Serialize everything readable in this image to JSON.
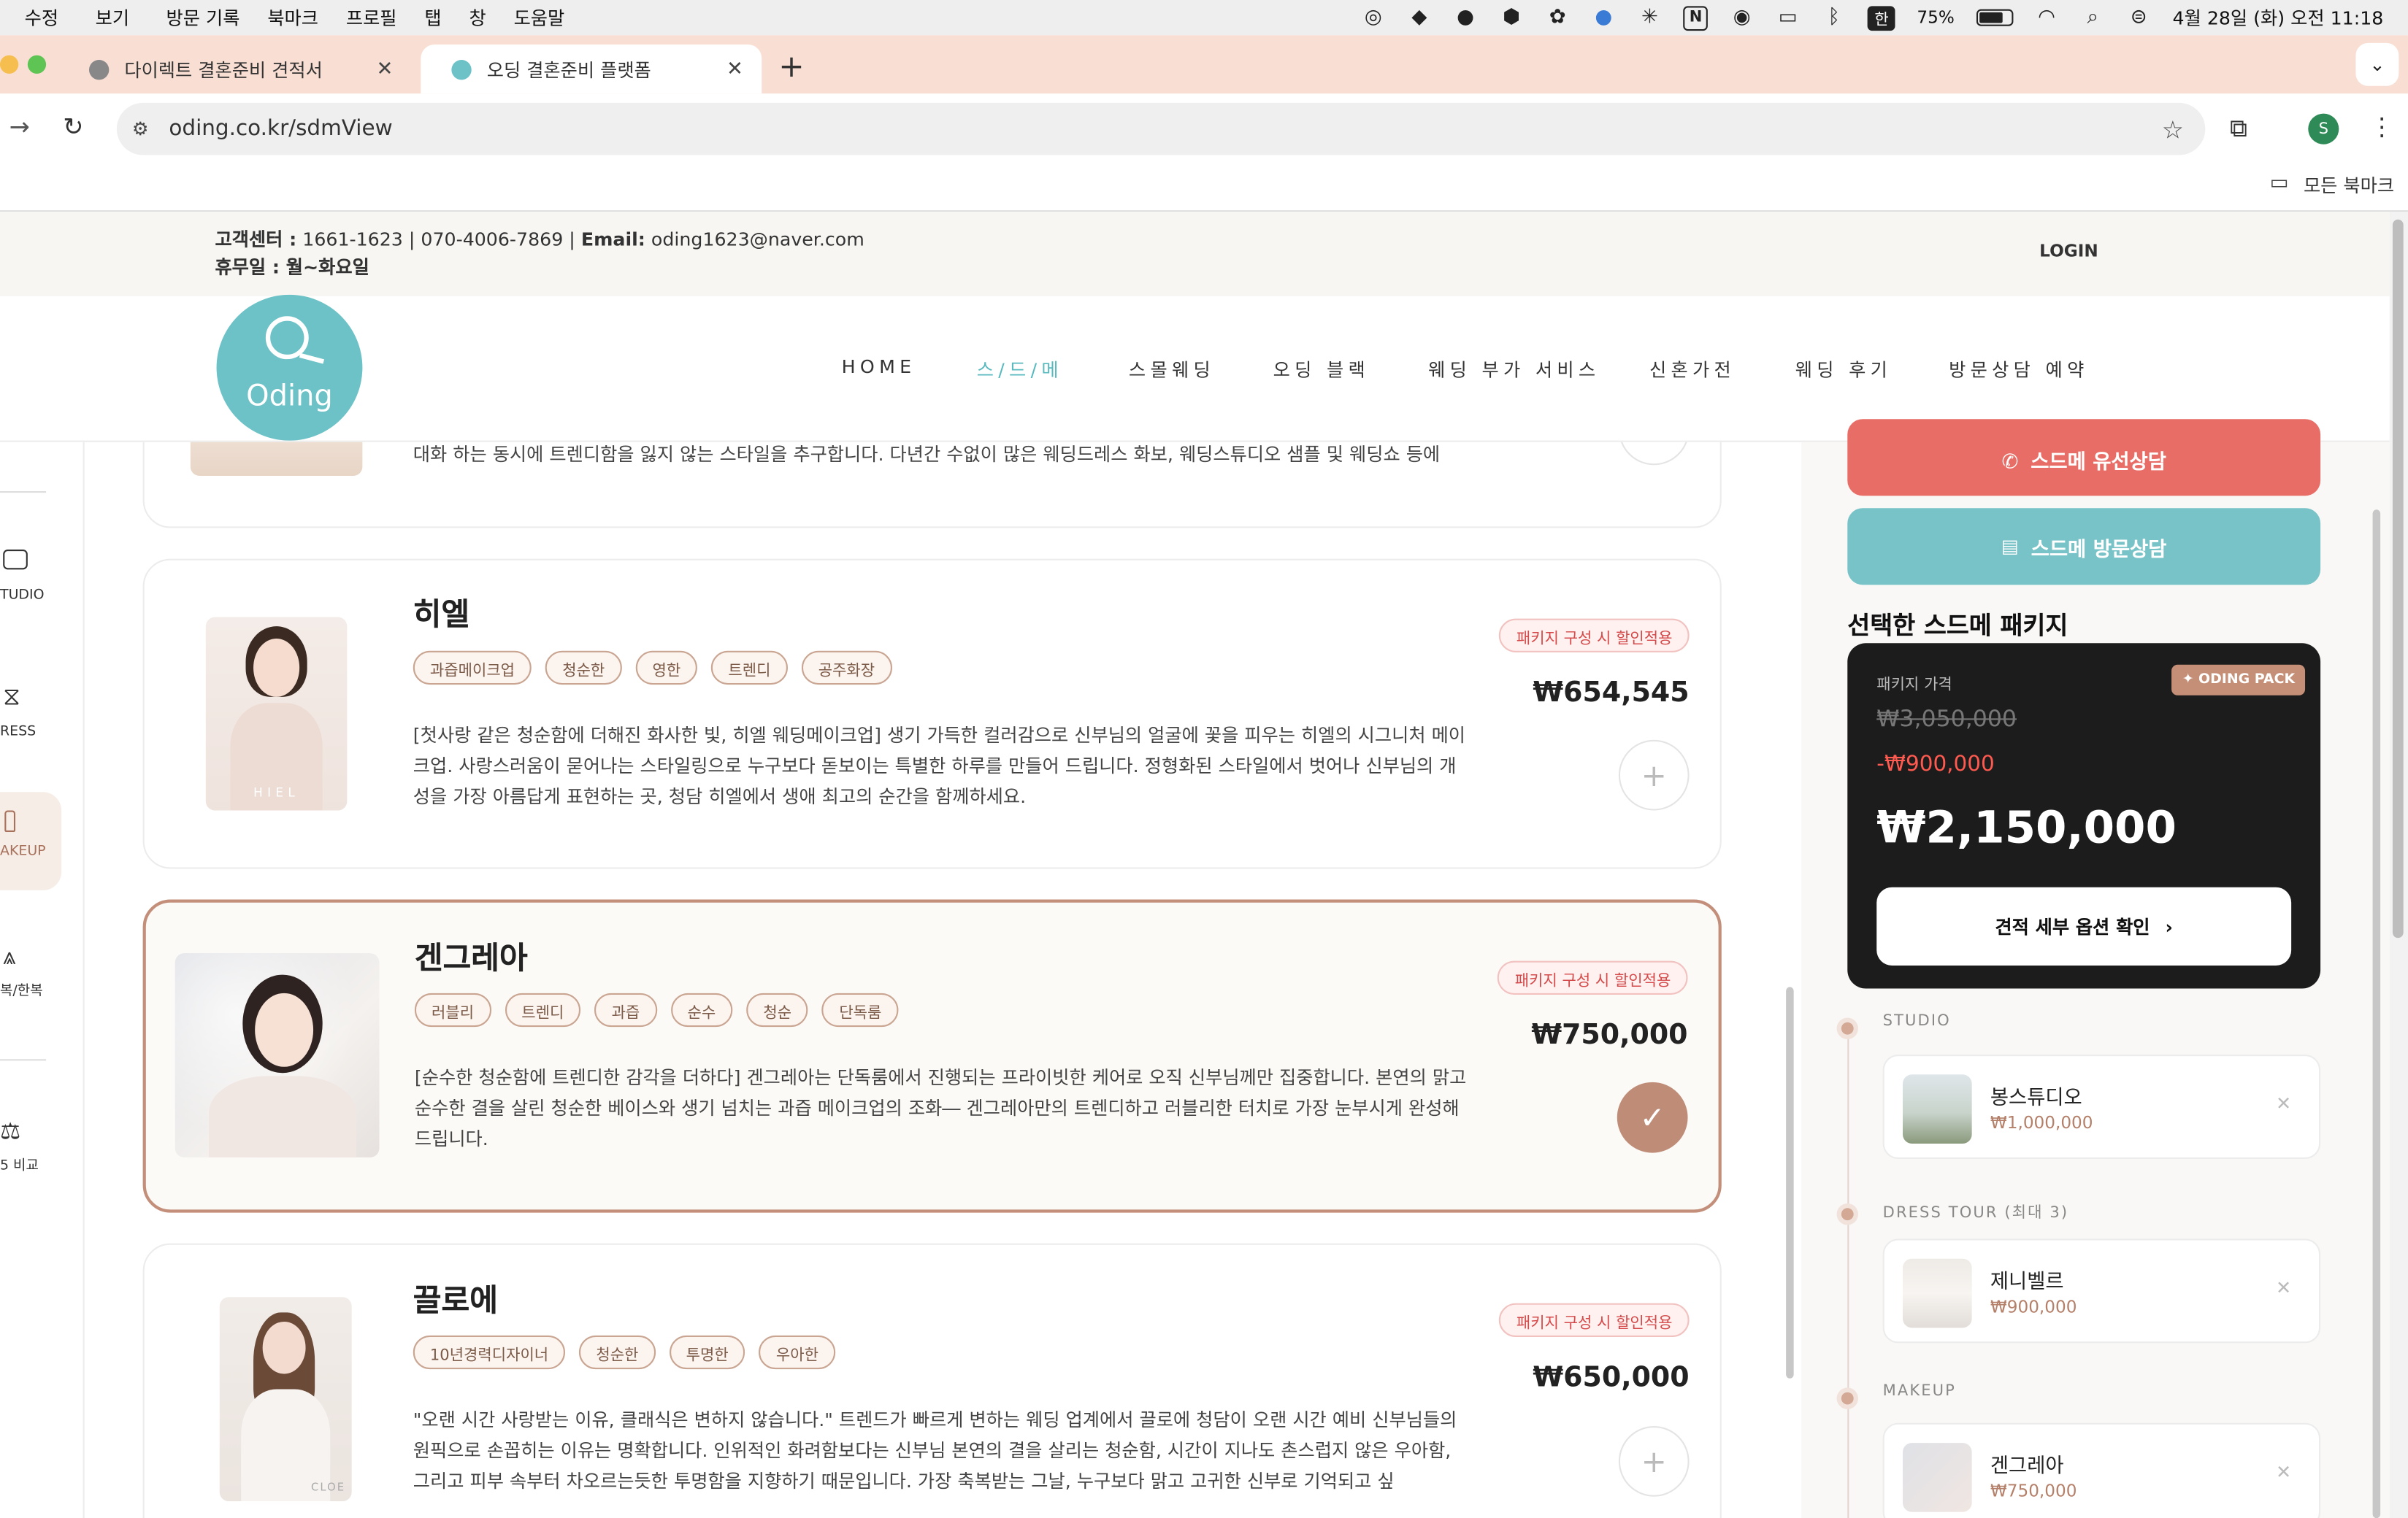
{
  "menubar": {
    "items": [
      "수정",
      "보기",
      "방문 기록",
      "북마크",
      "프로필",
      "탭",
      "창",
      "도움말"
    ],
    "ime": "한",
    "battery": "75%",
    "clock": "4월 28일 (화) 오전 11:18"
  },
  "browser": {
    "tabs": [
      {
        "title": "다이렉트 결혼준비 견적서"
      },
      {
        "title": "오딩 결혼준비 플랫폼"
      }
    ],
    "url": "oding.co.kr/sdmView",
    "bookmarks_label": "모든 북마크",
    "profile_initial": "S"
  },
  "site": {
    "info_line1_label": "고객센터 :",
    "info_line1_value": "1661-1623 | 070-4006-7869 |",
    "info_email_label": "Email:",
    "info_email": "oding1623@naver.com",
    "info_line2": "휴무일 : 월~화요일",
    "login": "LOGIN",
    "logo_text": "Oding",
    "nav": [
      "HOME",
      "스/드/메",
      "스몰웨딩",
      "오딩 블랙",
      "웨딩 부가 서비스",
      "신혼가전",
      "웨딩 후기",
      "방문상담 예약"
    ]
  },
  "rail": [
    {
      "label": "TUDIO",
      "icon": "camera-icon"
    },
    {
      "label": "RESS",
      "icon": "dress-icon"
    },
    {
      "label": "AKEUP",
      "icon": "lipstick-icon"
    },
    {
      "label": "복/한복",
      "icon": "hanbok-icon"
    },
    {
      "label": "5 비교",
      "icon": "scale-icon"
    }
  ],
  "cards": [
    {
      "desc": "대화 하는 동시에 트렌디함을 잃지 않는 스타일을 추구합니다. 다년간 수없이 많은 웨딩드레스 화보, 웨딩스튜디오 샘플 및 웨딩쇼 등에"
    },
    {
      "name": "히엘",
      "tags": [
        "과즙메이크업",
        "청순한",
        "영한",
        "트렌디",
        "공주화장"
      ],
      "badge": "패키지 구성 시 할인적용",
      "price": "₩654,545",
      "desc": "[첫사랑 같은 청순함에 더해진 화사한 빛, 히엘 웨딩메이크업] 생기 가득한 컬러감으로 신부님의 얼굴에 꽃을 피우는 히엘의 시그니처 메이크업. 사랑스러움이 묻어나는 스타일링으로 누구보다 돋보이는 특별한 하루를 만들어 드립니다. 정형화된 스타일에서 벗어나 신부님의 개성을 가장 아름답게 표현하는 곳, 청담 히엘에서 생애 최고의 순간을 함께하세요.",
      "img_caption": "HIEL"
    },
    {
      "name": "겐그레아",
      "tags": [
        "러블리",
        "트렌디",
        "과즙",
        "순수",
        "청순",
        "단독룸"
      ],
      "badge": "패키지 구성 시 할인적용",
      "price": "₩750,000",
      "desc": "[순수한 청순함에 트렌디한 감각을 더하다] 겐그레아는 단독룸에서 진행되는 프라이빗한 케어로 오직 신부님께만 집중합니다. 본연의 맑고 순수한 결을 살린 청순한 베이스와 생기 넘치는 과즙 메이크업의 조화― 겐그레아만의 트렌디하고 러블리한 터치로 가장 눈부시게 완성해 드립니다.",
      "selected": true
    },
    {
      "name": "끌로에",
      "tags": [
        "10년경력디자이너",
        "청순한",
        "투명한",
        "우아한"
      ],
      "badge": "패키지 구성 시 할인적용",
      "price": "₩650,000",
      "desc": "\"오랜 시간 사랑받는 이유, 클래식은 변하지 않습니다.\" 트렌드가 빠르게 변하는 웨딩 업계에서 끌로에 청담이 오랜 시간 예비 신부님들의 원픽으로 손꼽히는 이유는 명확합니다. 인위적인 화려함보다는 신부님 본연의 결을 살리는 청순함, 시간이 지나도 촌스럽지 않은 우아함, 그리고 피부 속부터 차오르는듯한 투명함을 지향하기 때문입니다. 가장 축복받는 그날, 누구보다 맑고 고귀한 신부로 기억되고 싶",
      "img_caption": "CLOE"
    }
  ],
  "side": {
    "call_btn": "스드메 유선상담",
    "visit_btn": "스드메 방문상담",
    "pack_title": "선택한 스드메 패키지",
    "pack_label": "패키지 가격",
    "pack_badge": "ODING PACK",
    "pack_original": "₩3,050,000",
    "pack_discount": "-₩900,000",
    "pack_total": "₩2,150,000",
    "pack_button": "견적 세부 옵션 확인",
    "sections": [
      {
        "label": "STUDIO",
        "name": "봉스튜디오",
        "price": "₩1,000,000"
      },
      {
        "label": "DRESS TOUR (최대 3)",
        "name": "제니벨르",
        "price": "₩900,000"
      },
      {
        "label": "MAKEUP",
        "name": "겐그레아",
        "price": "₩750,000"
      }
    ]
  },
  "colors": {
    "accent_teal": "#6cc2c6",
    "accent_rose": "#bf8c78",
    "call_red": "#e86d66",
    "pack_bg": "#1c1c1c"
  }
}
